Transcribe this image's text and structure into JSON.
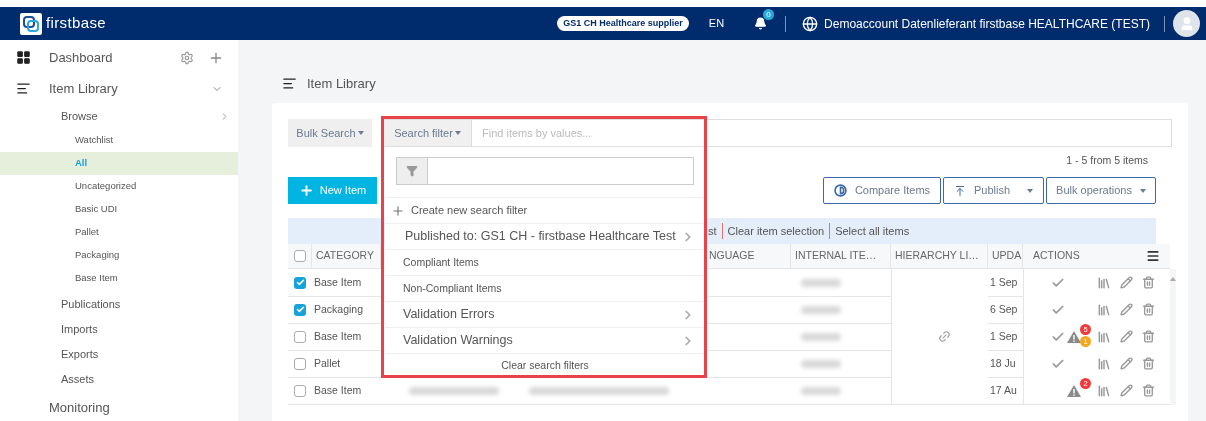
{
  "header": {
    "logo": "firstbase",
    "role_badge": "GS1 CH Healthcare supplier",
    "language": "EN",
    "notification_count": "0",
    "account": "Demoaccount Datenlieferant firstbase HEALTHCARE (TEST)"
  },
  "sidebar": {
    "items": [
      {
        "label": "Dashboard",
        "kind": "dashboard",
        "selected": false
      },
      {
        "label": "Item Library",
        "kind": "library",
        "selected": false,
        "children": [
          {
            "label": "Browse",
            "selected": false,
            "children": [
              {
                "label": "Watchlist",
                "selected": false
              },
              {
                "label": "All",
                "selected": true
              },
              {
                "label": "Uncategorized",
                "selected": false
              },
              {
                "label": "Basic UDI",
                "selected": false
              },
              {
                "label": "Pallet",
                "selected": false
              },
              {
                "label": "Packaging",
                "selected": false
              },
              {
                "label": "Base Item",
                "selected": false
              }
            ]
          },
          {
            "label": "Publications",
            "selected": false
          },
          {
            "label": "Imports",
            "selected": false
          },
          {
            "label": "Exports",
            "selected": false
          },
          {
            "label": "Assets",
            "selected": false
          }
        ]
      },
      {
        "label": "Monitoring",
        "kind": "plain",
        "selected": false
      }
    ]
  },
  "page_title": "Item Library",
  "toolbar": {
    "bulk_search": "Bulk Search",
    "search_filter": "Search filter",
    "search": {
      "placeholder": "Find items by values..."
    },
    "count": "1 - 5 from 5 items",
    "new_item": "New Item",
    "compare": "Compare Items",
    "publish": "Publish",
    "bulk_operations": "Bulk operations"
  },
  "selection_bar": [
    "st",
    "Clear item selection",
    "Select all items"
  ],
  "filter_menu": {
    "create": "Create new search filter",
    "items": [
      {
        "label": "Published to: GS1 CH - firstbase Healthcare Test",
        "kind": "submenu"
      },
      {
        "label": "Compliant Items",
        "kind": "plain"
      },
      {
        "label": "Non-Compliant Items",
        "kind": "plain"
      },
      {
        "label": "Validation Errors",
        "kind": "submenu"
      },
      {
        "label": "Validation Warnings",
        "kind": "submenu"
      }
    ],
    "clear": "Clear search filters"
  },
  "table": {
    "all_checked": false,
    "columns": [
      "CATEGORY",
      "NGUAGE",
      "INTERNAL ITE…",
      "HIERARCHY LI…",
      "UPDA",
      "ACTIONS"
    ],
    "rows": [
      {
        "checked": true,
        "category": "Base Item",
        "linked": false,
        "updated": "1 Sep",
        "compliant": true
      },
      {
        "checked": true,
        "category": "Packaging",
        "linked": false,
        "updated": "6 Sep",
        "compliant": true
      },
      {
        "checked": false,
        "category": "Base Item",
        "linked": true,
        "updated": "1 Sep",
        "compliant": true,
        "errors": "5",
        "warnings": "1"
      },
      {
        "checked": false,
        "category": "Pallet",
        "linked": false,
        "updated": "18 Ju",
        "compliant": true
      },
      {
        "checked": false,
        "category": "Base Item",
        "linked": false,
        "updated": "17 Au",
        "compliant": false,
        "errors": "2"
      }
    ]
  }
}
